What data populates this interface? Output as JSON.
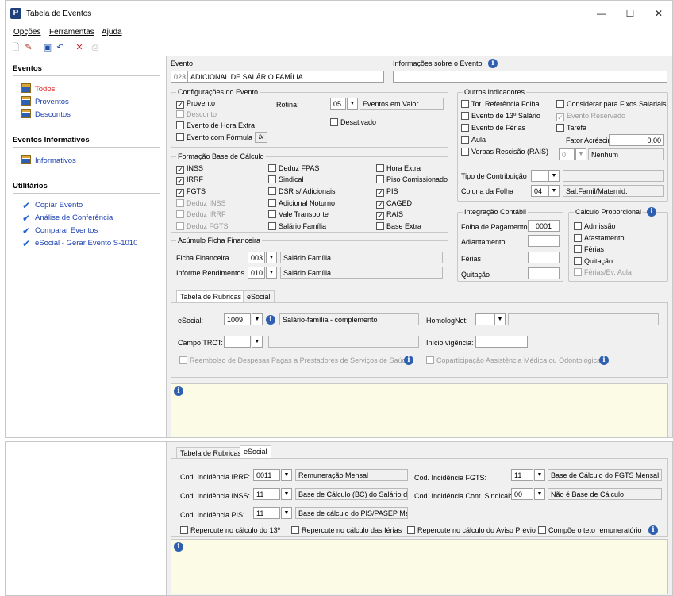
{
  "window": {
    "title": "Tabela de Eventos",
    "app_letter": "P",
    "minimize": "—",
    "maximize": "☐",
    "close": "✕"
  },
  "menu": [
    "Opções",
    "Ferramentas",
    "Ajuda"
  ],
  "toolbar": [
    "new-icon",
    "edit-icon",
    "save-icon",
    "undo-icon",
    "delete-icon",
    "print-icon"
  ],
  "sidebar": {
    "eventos_title": "Eventos",
    "eventos": [
      "Todos",
      "Proventos",
      "Descontos"
    ],
    "informativos_title": "Eventos Informativos",
    "informativos": [
      "Informativos"
    ],
    "utilitarios_title": "Utilitários",
    "utilitarios": [
      "Copiar Evento",
      "Análise de Conferência",
      "Comparar Eventos",
      "eSocial - Gerar Evento S-1010"
    ]
  },
  "evento": {
    "label": "Evento",
    "code": "023",
    "name": "ADICIONAL DE SALÁRIO FAMÍLIA",
    "info_label": "Informações sobre o Evento",
    "info_value": ""
  },
  "config": {
    "title": "Configurações do Evento",
    "provento": "Provento",
    "desconto": "Desconto",
    "hora_extra": "Evento de Hora Extra",
    "formula": "Evento com Fórmula",
    "fx": "fx",
    "rotina_label": "Rotina:",
    "rotina_code": "05",
    "rotina_name": "Eventos em Valor",
    "desativado": "Desativado"
  },
  "outros": {
    "title": "Outros Indicadores",
    "items_left": [
      "Tot. Referência Folha",
      "Evento de 13º Salário",
      "Evento de Férias",
      "Aula",
      "Verbas Rescisão (RAIS)"
    ],
    "items_right": [
      "Considerar para Fixos Salariais",
      "Evento Reservado",
      "Tarefa"
    ],
    "fator_label": "Fator Acréscimo",
    "fator_value": "0,00",
    "rais_code": "0",
    "rais_name": "Nenhum",
    "tipo_contrib_label": "Tipo de Contribuição",
    "tipo_contrib_value": "",
    "tipo_contrib_desc": "",
    "coluna_label": "Coluna da Folha",
    "coluna_code": "04",
    "coluna_name": "Sal.Famil/Maternid."
  },
  "formacao": {
    "title": "Formação Base de Cálculo",
    "col1": [
      "INSS",
      "IRRF",
      "FGTS",
      "Deduz INSS",
      "Deduz IRRF",
      "Deduz FGTS"
    ],
    "col2": [
      "Deduz FPAS",
      "Sindical",
      "DSR s/ Adicionais",
      "Adicional Noturno",
      "Vale Transporte",
      "Salário Família"
    ],
    "col3": [
      "Hora Extra",
      "Piso Comissionado",
      "PIS",
      "CAGED",
      "RAIS",
      "Base Extra"
    ],
    "checked": "✓"
  },
  "acumulo": {
    "title": "Acúmulo Ficha Financeira",
    "ficha_label": "Ficha Financeira",
    "ficha_code": "003",
    "ficha_name": "Salário Família",
    "informe_label": "Informe Rendimentos",
    "informe_code": "010",
    "informe_name": "Salário Família"
  },
  "integracao": {
    "title": "Integração Contábil",
    "folha_label": "Folha de Pagamento",
    "folha_value": "0001",
    "adiantamento_label": "Adiantamento",
    "ferias_label": "Férias",
    "quitacao_label": "Quitação"
  },
  "calculo": {
    "title": "Cálculo Proporcional",
    "items": [
      "Admissão",
      "Afastamento",
      "Férias",
      "Quitação",
      "Férias/Ev. Aula"
    ]
  },
  "tabs": {
    "rubricas": "Tabela de Rubricas",
    "esocial": "eSocial"
  },
  "rubricas": {
    "esocial_label": "eSocial:",
    "esocial_code": "1009",
    "esocial_desc": "Salário-família - complemento",
    "homolog_label": "HomologNet:",
    "homolog_value": "",
    "homolog_desc": "",
    "campo_trct_label": "Campo TRCT:",
    "campo_trct_value": "",
    "campo_trct_desc": "",
    "inicio_label": "Início vigência:",
    "inicio_value": "",
    "reembolso": "Reembolso de Despesas Pagas a Prestadores de Serviços de Saúde",
    "coparticipacao": "Coparticipação Assistência Médica ou Odontológica"
  },
  "esocial_tab": {
    "irrf_label": "Cod. Incidência IRRF:",
    "irrf_code": "0011",
    "irrf_desc": "Remuneração Mensal",
    "inss_label": "Cod. Incidência INSS:",
    "inss_code": "11",
    "inss_desc": "Base de Cálculo (BC) do Salário de Cor",
    "pis_label": "Cod. Incidência PIS:",
    "pis_code": "11",
    "pis_desc": "Base de cálculo do PIS/PASEP Mensal",
    "fgts_label": "Cod. Incidência FGTS:",
    "fgts_code": "11",
    "fgts_desc": "Base de Cálculo do FGTS Mensal",
    "sindical_label": "Cod. Incidência Cont. Sindical:",
    "sindical_code": "00",
    "sindical_desc": "Não é Base de Cálculo",
    "checks": [
      "Repercute no cálculo do 13º",
      "Repercute no cálculo das férias",
      "Repercute no cálculo do Aviso Prévio",
      "Compõe o teto remuneratório"
    ]
  },
  "info_glyph": "i",
  "dropdown_glyph": "▼"
}
